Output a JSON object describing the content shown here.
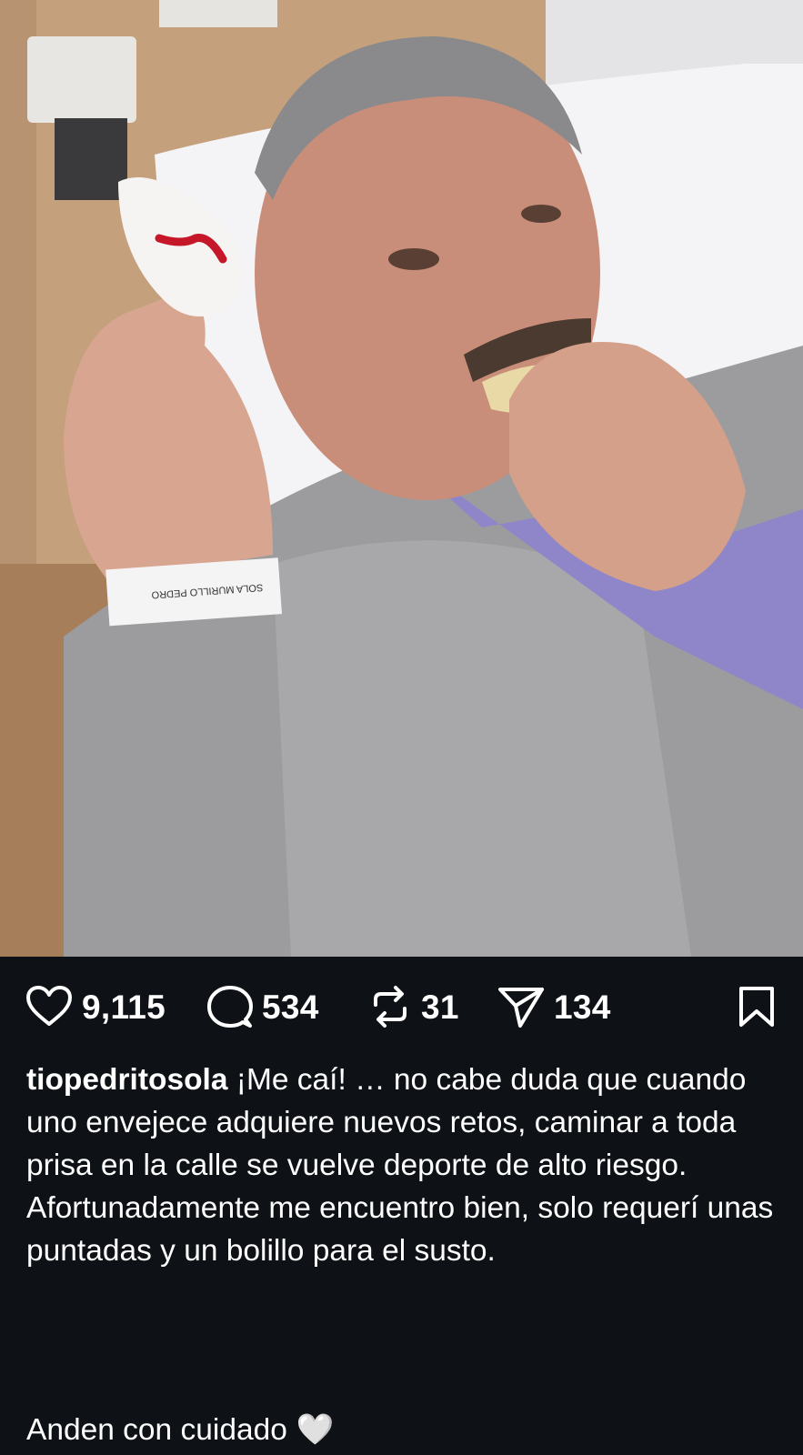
{
  "post": {
    "photo": {
      "description_icon": "hospital-selfie-photo",
      "wristband_text": "SOLA MURILLO PEDRO"
    },
    "actions": {
      "likes": "9,115",
      "comments": "534",
      "reposts": "31",
      "shares": "134"
    },
    "caption": {
      "username": "tiopedritosola",
      "text": "¡Me caí! … no cabe duda que cuando uno envejece adquiere nuevos retos, caminar a toda prisa en la calle se vuelve deporte de alto riesgo. Afortunadamente me encuentro bien, solo requerí unas puntadas y un bolillo para el susto.",
      "closing": "Anden con cuidado",
      "closing_emoji": "🤍"
    },
    "colors": {
      "background": "#0e1217",
      "text": "#ffffff"
    }
  }
}
